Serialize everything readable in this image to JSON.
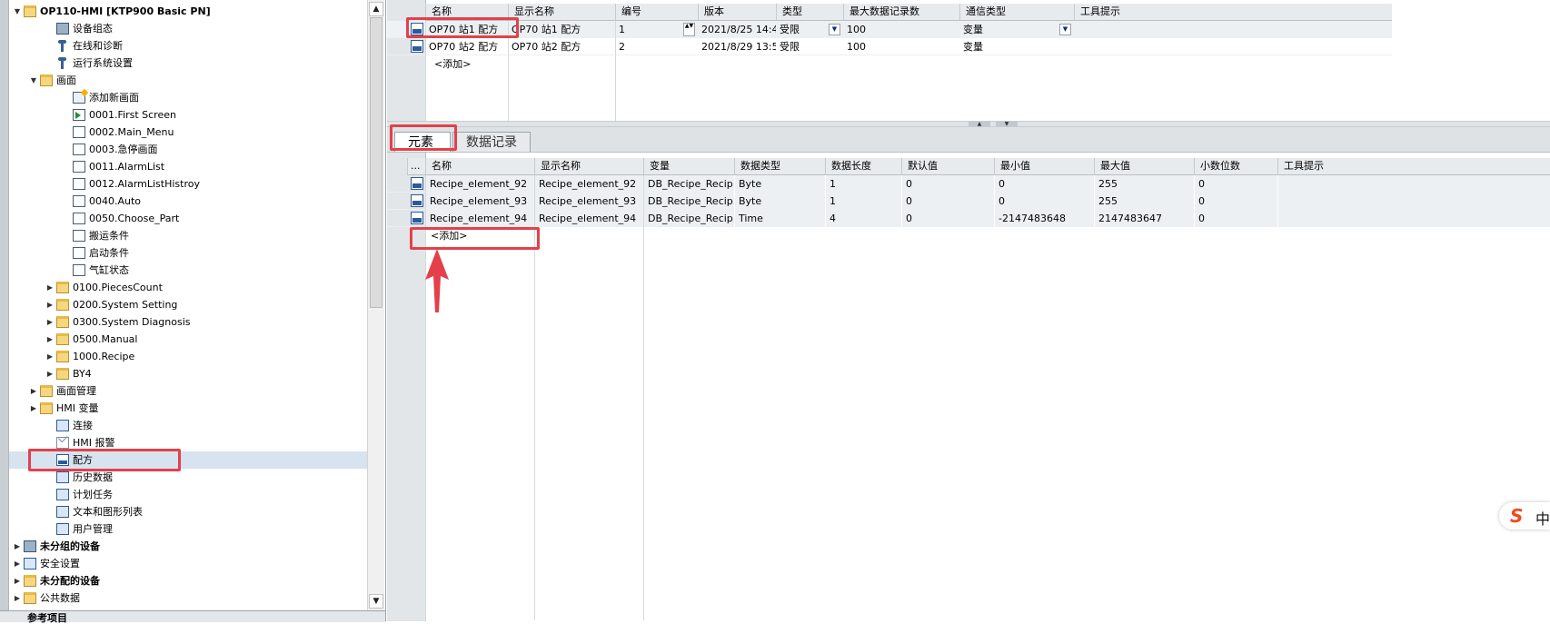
{
  "tree": {
    "items": [
      {
        "label": "OP110-HMI [KTP900 Basic PN]",
        "bold": true,
        "arrow": "down",
        "icon": "folder",
        "indent": 1
      },
      {
        "label": "设备组态",
        "icon": "device",
        "indent": 3
      },
      {
        "label": "在线和诊断",
        "icon": "tool",
        "indent": 3
      },
      {
        "label": "运行系统设置",
        "icon": "tool",
        "indent": 3
      },
      {
        "label": "画面",
        "arrow": "down",
        "icon": "folder",
        "indent": 2
      },
      {
        "label": "添加新画面",
        "icon": "newscreen",
        "indent": 4
      },
      {
        "label": "0001.First Screen",
        "icon": "screen-green",
        "indent": 4
      },
      {
        "label": "0002.Main_Menu",
        "icon": "screen",
        "indent": 4
      },
      {
        "label": "0003.急停画面",
        "icon": "screen",
        "indent": 4
      },
      {
        "label": "0011.AlarmList",
        "icon": "screen",
        "indent": 4
      },
      {
        "label": "0012.AlarmListHistroy",
        "icon": "screen",
        "indent": 4
      },
      {
        "label": "0040.Auto",
        "icon": "screen",
        "indent": 4
      },
      {
        "label": "0050.Choose_Part",
        "icon": "screen",
        "indent": 4
      },
      {
        "label": "搬运条件",
        "icon": "screen",
        "indent": 4
      },
      {
        "label": "启动条件",
        "icon": "screen",
        "indent": 4
      },
      {
        "label": "气缸状态",
        "icon": "screen",
        "indent": 4
      },
      {
        "label": "0100.PiecesCount",
        "arrow": "right",
        "icon": "folder",
        "indent": 3
      },
      {
        "label": "0200.System Setting",
        "arrow": "right",
        "icon": "folder",
        "indent": 3
      },
      {
        "label": "0300.System Diagnosis",
        "arrow": "right",
        "icon": "folder",
        "indent": 3
      },
      {
        "label": "0500.Manual",
        "arrow": "right",
        "icon": "folder",
        "indent": 3
      },
      {
        "label": "1000.Recipe",
        "arrow": "right",
        "icon": "folder",
        "indent": 3
      },
      {
        "label": "BY4",
        "arrow": "right",
        "icon": "folder",
        "indent": 3
      },
      {
        "label": "画面管理",
        "arrow": "right",
        "icon": "folder",
        "indent": 2
      },
      {
        "label": "HMI 变量",
        "arrow": "right",
        "icon": "folder",
        "indent": 2
      },
      {
        "label": "连接",
        "icon": "blue",
        "indent": 3
      },
      {
        "label": "HMI 报警",
        "icon": "mail",
        "indent": 3
      },
      {
        "label": "配方",
        "icon": "recipe",
        "indent": 3,
        "selected": true
      },
      {
        "label": "历史数据",
        "icon": "blue",
        "indent": 3
      },
      {
        "label": "计划任务",
        "icon": "blue",
        "indent": 3
      },
      {
        "label": "文本和图形列表",
        "icon": "blue",
        "indent": 3
      },
      {
        "label": "用户管理",
        "icon": "blue",
        "indent": 3
      },
      {
        "label": "未分组的设备",
        "bold": true,
        "arrow": "right",
        "icon": "device",
        "indent": 1
      },
      {
        "label": "安全设置",
        "arrow": "right",
        "icon": "blue",
        "indent": 1
      },
      {
        "label": "未分配的设备",
        "bold": true,
        "arrow": "right",
        "icon": "folder",
        "indent": 1
      },
      {
        "label": "公共数据",
        "arrow": "right",
        "icon": "folder",
        "indent": 1
      }
    ],
    "footer_label": "参考项目"
  },
  "recipes": {
    "columns": [
      "名称",
      "显示名称",
      "编号",
      "版本",
      "类型",
      "最大数据记录数",
      "通信类型",
      "工具提示"
    ],
    "rows": [
      {
        "name": "OP70 站1 配方",
        "display": "OP70 站1 配方",
        "number": "1",
        "version": "2021/8/25 14:4...",
        "type": "受限",
        "max_records": "100",
        "comm": "变量",
        "tooltip": ""
      },
      {
        "name": "OP70 站2 配方",
        "display": "OP70 站2 配方",
        "number": "2",
        "version": "2021/8/29 13:5...",
        "type": "受限",
        "max_records": "100",
        "comm": "变量",
        "tooltip": ""
      }
    ],
    "add_label": "<添加>"
  },
  "tabs": [
    {
      "label": "元素",
      "active": true
    },
    {
      "label": "数据记录",
      "active": false
    }
  ],
  "elements": {
    "columns": [
      "...",
      "名称",
      "显示名称",
      "变量",
      "数据类型",
      "数据长度",
      "默认值",
      "最小值",
      "最大值",
      "小数位数",
      "工具提示"
    ],
    "rows": [
      {
        "name": "Recipe_element_92",
        "display": "Recipe_element_92",
        "tag": "DB_Recipe_Recip...",
        "dtype": "Byte",
        "length": "1",
        "default": "0",
        "min": "0",
        "max": "255",
        "decimals": "0",
        "tooltip": ""
      },
      {
        "name": "Recipe_element_93",
        "display": "Recipe_element_93",
        "tag": "DB_Recipe_Recip...",
        "dtype": "Byte",
        "length": "1",
        "default": "0",
        "min": "0",
        "max": "255",
        "decimals": "0",
        "tooltip": ""
      },
      {
        "name": "Recipe_element_94",
        "display": "Recipe_element_94",
        "tag": "DB_Recipe_Recip...",
        "dtype": "Time",
        "length": "4",
        "default": "0",
        "min": "-2147483648",
        "max": "2147483647",
        "decimals": "0",
        "tooltip": ""
      }
    ],
    "add_label": "<添加>"
  },
  "overlay": {
    "ime_logo": "S",
    "ime_text": "中"
  },
  "colors": {
    "highlight": "#e4404a",
    "selection": "#d7e3ef",
    "header_bg": "#e8ebee"
  }
}
